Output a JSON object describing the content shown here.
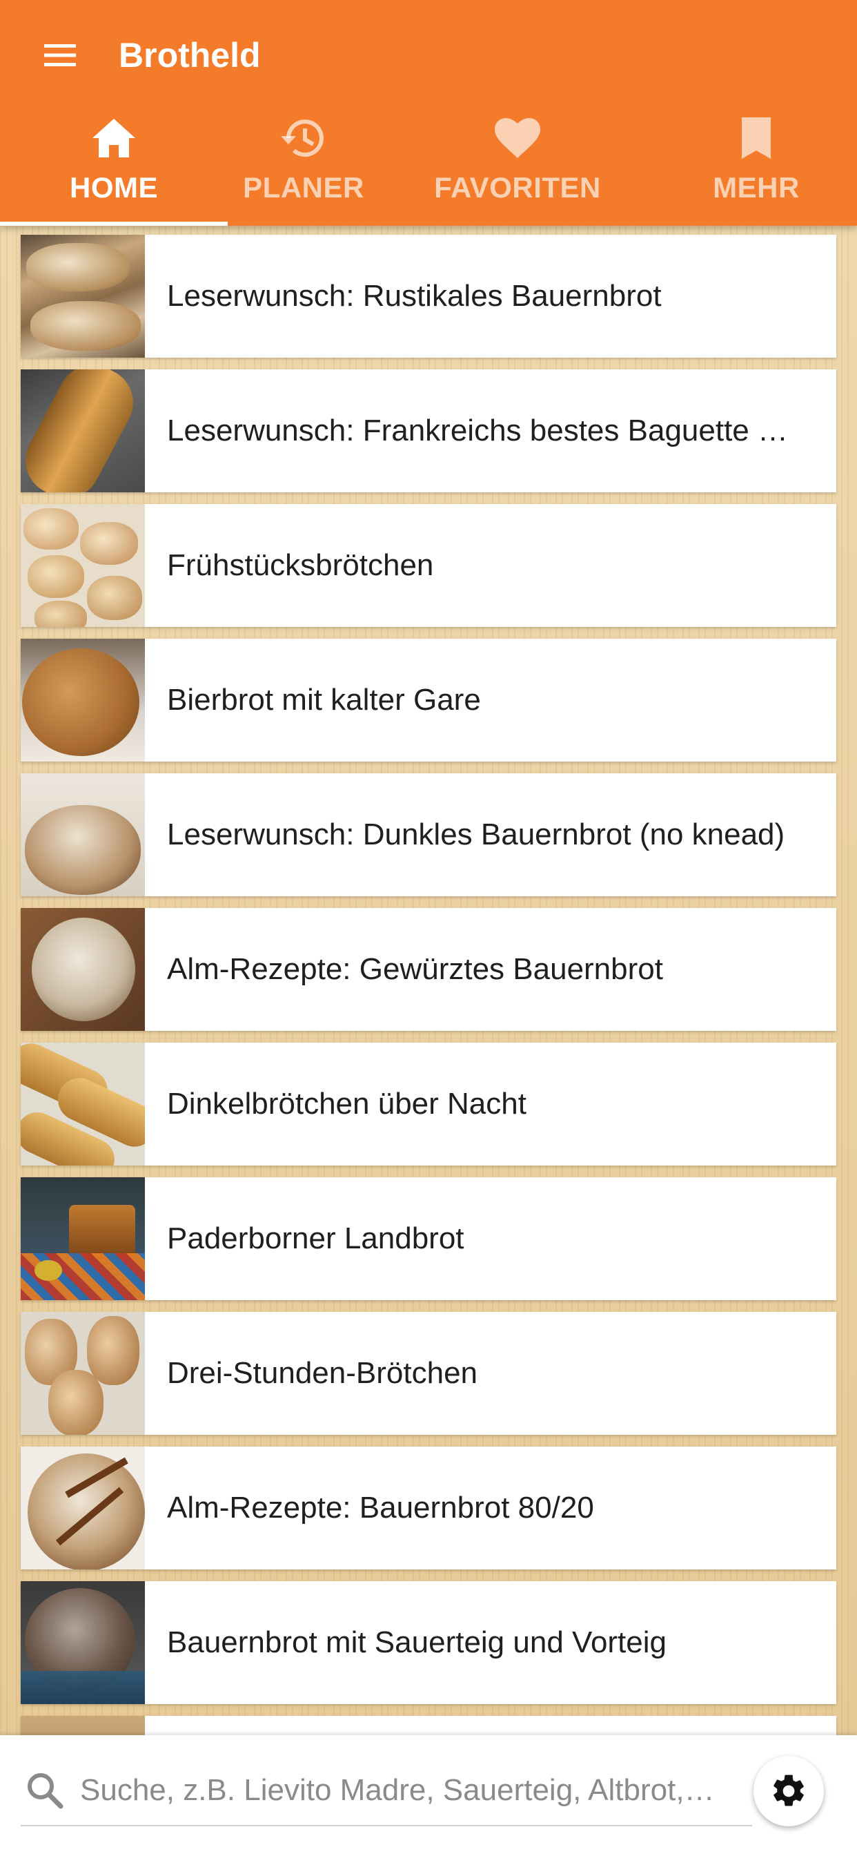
{
  "app": {
    "title": "Brotheld",
    "accent_color": "#f47b2a"
  },
  "tabs": [
    {
      "label": "HOME",
      "icon": "home-icon",
      "active": true
    },
    {
      "label": "PLANER",
      "icon": "history-icon",
      "active": false
    },
    {
      "label": "FAVORITEN",
      "icon": "heart-icon",
      "active": false
    },
    {
      "label": "MEHR",
      "icon": "bookmark-icon",
      "active": false
    }
  ],
  "recipes": [
    {
      "title": "Leserwunsch: Rustikales Bauernbrot"
    },
    {
      "title": "Leserwunsch: Frankreichs bestes Baguette …"
    },
    {
      "title": "Frühstücksbrötchen"
    },
    {
      "title": "Bierbrot mit kalter Gare"
    },
    {
      "title": "Leserwunsch: Dunkles Bauernbrot (no knead)"
    },
    {
      "title": "Alm-Rezepte: Gewürztes Bauernbrot"
    },
    {
      "title": "Dinkelbrötchen über Nacht"
    },
    {
      "title": "Paderborner Landbrot"
    },
    {
      "title": "Drei-Stunden-Brötchen"
    },
    {
      "title": "Alm-Rezepte: Bauernbrot 80/20"
    },
    {
      "title": "Bauernbrot mit Sauerteig und Vorteig"
    }
  ],
  "search": {
    "placeholder": "Suche, z.B. Lievito Madre, Sauerteig, Altbrot,…",
    "icon": "search-icon"
  },
  "settings": {
    "icon": "gear-icon"
  }
}
